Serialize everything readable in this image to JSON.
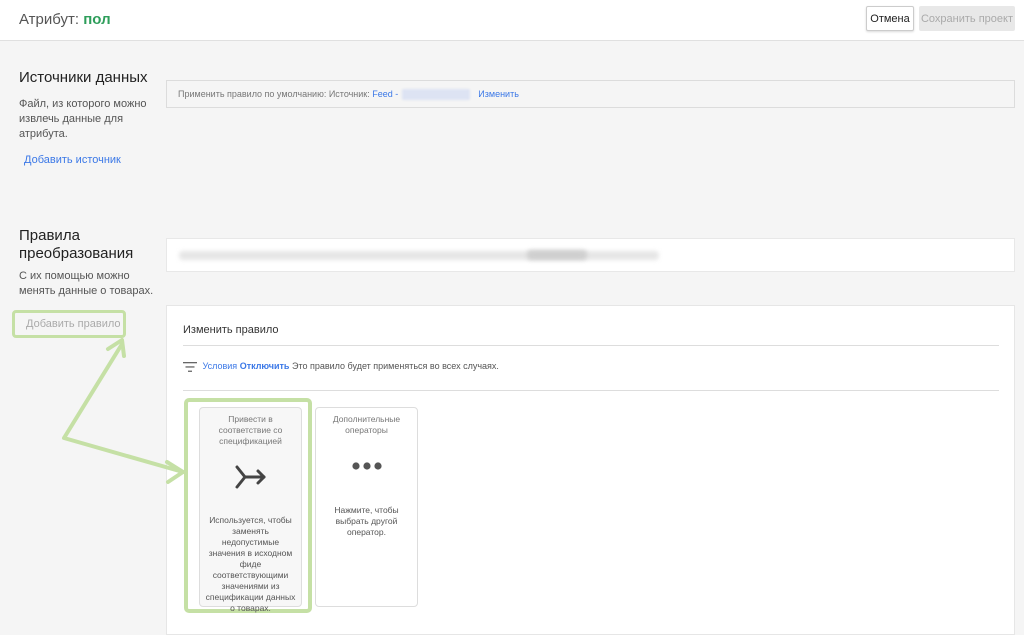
{
  "header": {
    "title_prefix": "Атрибут:",
    "title_value": "пол",
    "cancel_label": "Отмена",
    "save_label": "Сохранить проект"
  },
  "sources": {
    "title": "Источники данных",
    "description_1": "Файл, из которого можно",
    "description_2": "извлечь данные для",
    "description_3": "атрибута.",
    "add_label": "Добавить источник",
    "default_rule_text": "Применить правило по умолчанию: Источник:",
    "feed_label": "Feed -",
    "change_label": "Изменить"
  },
  "rules": {
    "title_1": "Правила",
    "title_2": "преобразования",
    "description_1": "С их помощью можно",
    "description_2": "менять данные о товарах.",
    "add_label": "Добавить правило"
  },
  "edit_panel": {
    "title": "Изменить правило",
    "conditions_label": "Условия",
    "disable_label": "Отключить",
    "conditions_text": "Это правило будет применяться во всех случаях."
  },
  "cards": [
    {
      "title_lines": [
        "Привести в",
        "соответствие со",
        "спецификацией"
      ],
      "icon": "merge-arrow-icon",
      "description_lines": [
        "Используется, чтобы",
        "заменять",
        "недопустимые",
        "значения в исходном",
        "фиде",
        "соответствующими",
        "значениями из",
        "спецификации данных",
        "о товарах."
      ]
    },
    {
      "title_lines": [
        "Дополнительные",
        "операторы"
      ],
      "icon": "more-dots-icon",
      "description_lines": [
        "Нажмите, чтобы",
        "выбрать другой",
        "оператор."
      ]
    }
  ],
  "colors": {
    "accent_blue": "#3b78e7",
    "highlight_green": "#c5e0a5",
    "attribute_green": "#2e9e5b"
  }
}
